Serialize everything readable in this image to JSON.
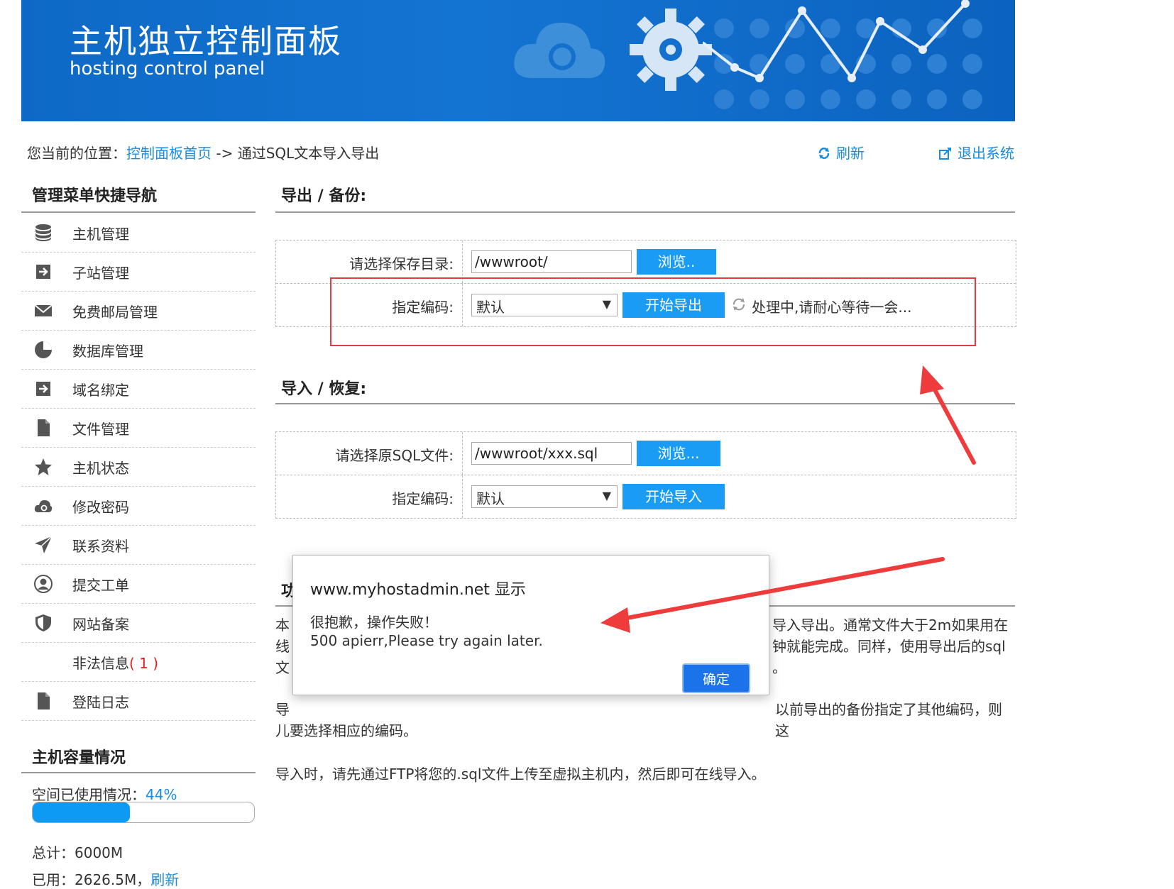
{
  "banner": {
    "title": "主机独立控制面板",
    "subtitle": "hosting control panel"
  },
  "breadcrumb": {
    "prefix": "您当前的位置：",
    "home_link": "控制面板首页",
    "separator": " -> ",
    "current": "通过SQL文本导入导出"
  },
  "top_actions": {
    "refresh": "刷新",
    "logout": "退出系统"
  },
  "sidebar": {
    "title": "管理菜单快捷导航",
    "items": [
      {
        "label": "主机管理",
        "icon": "database-icon"
      },
      {
        "label": "子站管理",
        "icon": "arrow-box-icon"
      },
      {
        "label": "免费邮局管理",
        "icon": "mail-icon"
      },
      {
        "label": "数据库管理",
        "icon": "pie-chart-icon"
      },
      {
        "label": "域名绑定",
        "icon": "arrow-box-icon"
      },
      {
        "label": "文件管理",
        "icon": "file-icon"
      },
      {
        "label": "主机状态",
        "icon": "star-icon"
      },
      {
        "label": "修改密码",
        "icon": "cloud-icon"
      },
      {
        "label": "联系资料",
        "icon": "send-icon"
      },
      {
        "label": "提交工单",
        "icon": "user-icon"
      },
      {
        "label": "网站备案",
        "icon": "shield-icon"
      },
      {
        "label": "非法信息",
        "count": "( 1 )",
        "icon": ""
      },
      {
        "label": "登陆日志",
        "icon": "file-icon"
      }
    ],
    "usage_title": "主机容量情况",
    "usage_label": "空间已使用情况：",
    "usage_percent": "44%",
    "usage_fraction": 0.44,
    "total_label": "总计：6000M",
    "used_label": "已用：2626.5M，",
    "used_refresh": "刷新"
  },
  "export": {
    "title": "导出 / 备份:",
    "dir_label": "请选择保存目录:",
    "dir_value": "/wwwroot/",
    "browse": "浏览..",
    "enc_label": "指定编码:",
    "enc_value": "默认",
    "start_button": "开始导出",
    "status": "处理中,请耐心等待一会..."
  },
  "import": {
    "title": "导入 / 恢复:",
    "file_label": "请选择原SQL文件:",
    "file_value": "/wwwroot/xxx.sql",
    "browse": "浏览...",
    "enc_label": "指定编码:",
    "enc_value": "默认",
    "start_button": "开始导入"
  },
  "info": {
    "title_fragment": "功",
    "p1_start": "本",
    "p1_end": "导入导出。通常文件大于2m如果用在",
    "p2_start": "线",
    "p2_end": "钟就能完成。同样，使用导出后的sql",
    "p3_start": "文",
    "p3_end": "。",
    "p4_start": "导",
    "p4_end": "以前导出的备份指定了其他编码，则这",
    "p4_line2": "儿要选择相应的编码。",
    "p5": "导入时，请先通过FTP将您的.sql文件上传至虚拟主机内，然后即可在线导入。"
  },
  "dialog": {
    "title": "www.myhostadmin.net 显示",
    "message_line1": "很抱歉，操作失败！",
    "message_line2": "500 apierr,Please try again later.",
    "ok": "确定"
  },
  "colors": {
    "banner": "#0e69c6",
    "link": "#1a8ce0",
    "button": "#1a9cf5",
    "highlight": "#e23b3b",
    "dialog_button": "#1a73e8"
  }
}
